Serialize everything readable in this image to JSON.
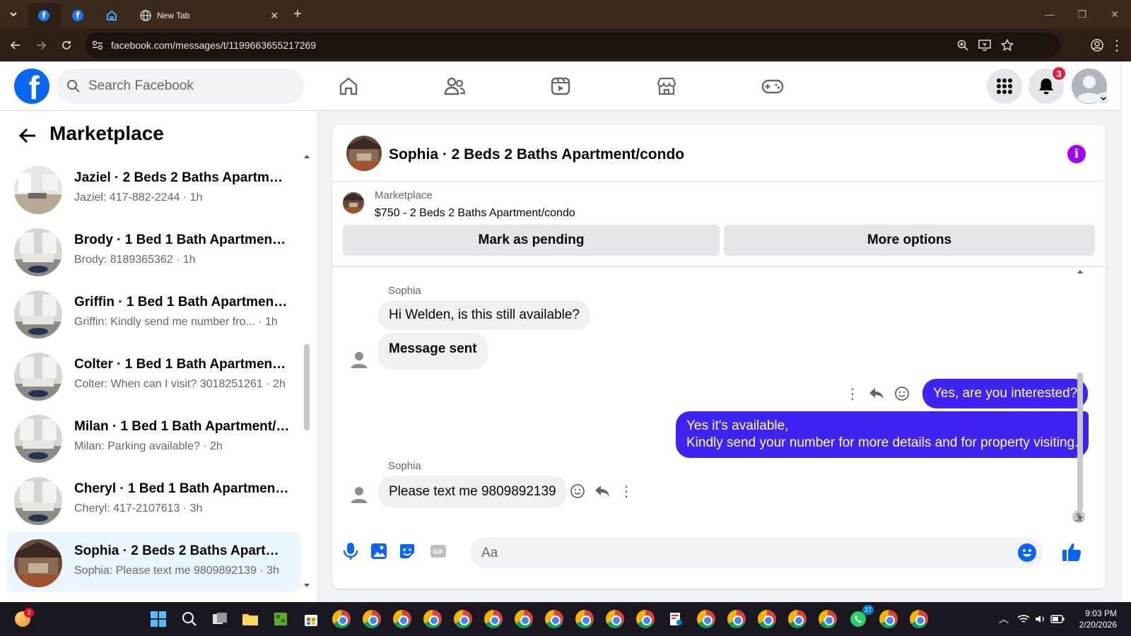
{
  "browser": {
    "tabs": [
      {
        "label": ""
      },
      {
        "label": ""
      },
      {
        "label": ""
      },
      {
        "label": "New Tab"
      }
    ],
    "url": "facebook.com/messages/t/1199663655217269"
  },
  "header": {
    "search_placeholder": "Search Facebook",
    "notification_count": "3"
  },
  "sidebar": {
    "title": "Marketplace",
    "conversations": [
      {
        "title": "Jaziel · 2 Beds 2 Baths Apartmen...",
        "snippet": "Jaziel: 417-882-2244 · 1h"
      },
      {
        "title": "Brody · 1 Bed 1 Bath Apartment/...",
        "snippet": "Brody: 8189365362 · 1h"
      },
      {
        "title": "Griffin · 1 Bed 1 Bath Apartment/...",
        "snippet": "Griffin: Kindly send me number fro...   · 1h"
      },
      {
        "title": "Colter · 1 Bed 1 Bath Apartment/...",
        "snippet": "Colter: When can I visit? 3018251261 · 2h"
      },
      {
        "title": "Milan · 1 Bed 1 Bath Apartment/c...",
        "snippet": "Milan: Parking available? · 2h"
      },
      {
        "title": "Cheryl · 1 Bed 1 Bath Apartment/...",
        "snippet": "Cheryl: 417-2107613 · 3h"
      },
      {
        "title": "Sophia · 2 Beds 2 Baths Apartme...",
        "snippet": "Sophia: Please text me 9809892139 · 3h"
      }
    ]
  },
  "chat": {
    "title": "Sophia · 2 Beds 2 Baths Apartment/condo",
    "listing_source": "Marketplace",
    "listing_title": "$750 - 2 Beds 2 Baths Apartment/condo",
    "mark_pending": "Mark as pending",
    "more_options": "More options",
    "sender_name": "Sophia",
    "messages": {
      "m1": "Hi Welden, is this still available?",
      "m2": "Message sent",
      "m3": "Yes, are you interested?",
      "m4a": "Yes it's available,",
      "m4b": "Kindly send your number for more details and for property visiting.",
      "m5": "Please text me 9809892139"
    },
    "composer_placeholder": "Aa"
  },
  "taskbar": {
    "time": "9:03 PM",
    "date": "2/20/2026",
    "whatsapp_badge": "27",
    "weather_badge": "2"
  }
}
